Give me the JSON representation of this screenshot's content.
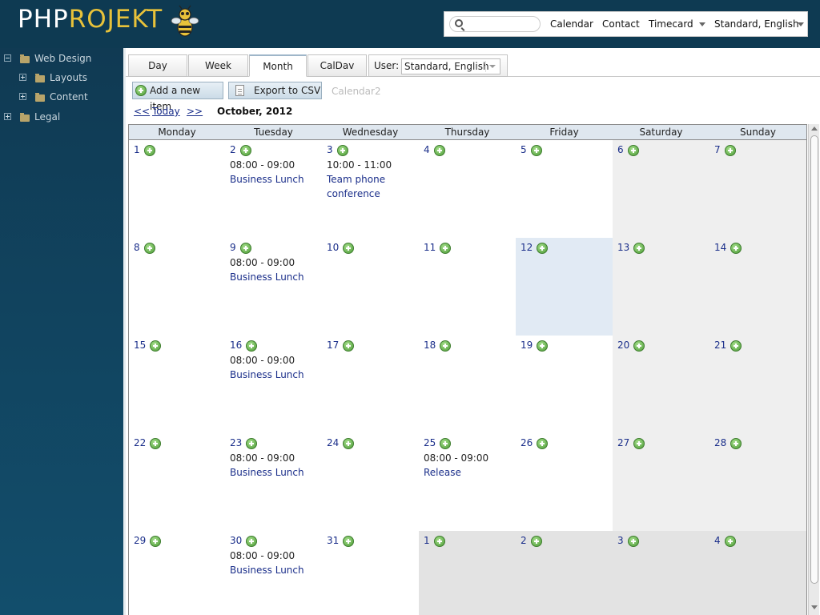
{
  "header": {
    "logo_php": "PHP",
    "logo_projekt": "ROJEKT",
    "nav": [
      "Calendar",
      "Contact",
      "Timecard"
    ],
    "user_menu": "Standard, English",
    "search_placeholder": ""
  },
  "sidebar": {
    "items": [
      {
        "label": "Web Design",
        "expanded": true
      },
      {
        "label": "Layouts"
      },
      {
        "label": "Content"
      },
      {
        "label": "Legal"
      }
    ]
  },
  "tabs": [
    {
      "label": "Day"
    },
    {
      "label": "Week"
    },
    {
      "label": "Month",
      "active": true
    },
    {
      "label": "CalDav"
    }
  ],
  "user_filter": {
    "label": "User:",
    "value": "Standard, English"
  },
  "toolbar": {
    "add_label": "Add a new item",
    "export_label": "Export to CSV",
    "calendar2_label": "Calendar2"
  },
  "nav": {
    "prev": "<<",
    "today": "Today",
    "next": ">>",
    "title": "October, 2012"
  },
  "weekdays": [
    "Monday",
    "Tuesday",
    "Wednesday",
    "Thursday",
    "Friday",
    "Saturday",
    "Sunday"
  ],
  "weeks": [
    [
      {
        "day": "1"
      },
      {
        "day": "2",
        "time": "08:00 - 09:00",
        "title": "Business Lunch"
      },
      {
        "day": "3",
        "time": "10:00 - 11:00",
        "title": "Team phone conference",
        "time_inline": true
      },
      {
        "day": "4"
      },
      {
        "day": "5"
      },
      {
        "day": "6",
        "weekend": true
      },
      {
        "day": "7",
        "weekend": true
      }
    ],
    [
      {
        "day": "8"
      },
      {
        "day": "9",
        "time": "08:00 - 09:00",
        "title": "Business Lunch"
      },
      {
        "day": "10"
      },
      {
        "day": "11"
      },
      {
        "day": "12",
        "today": true
      },
      {
        "day": "13",
        "weekend": true
      },
      {
        "day": "14",
        "weekend": true
      }
    ],
    [
      {
        "day": "15"
      },
      {
        "day": "16",
        "time": "08:00 - 09:00",
        "title": "Business Lunch"
      },
      {
        "day": "17"
      },
      {
        "day": "18"
      },
      {
        "day": "19"
      },
      {
        "day": "20",
        "weekend": true
      },
      {
        "day": "21",
        "weekend": true
      }
    ],
    [
      {
        "day": "22"
      },
      {
        "day": "23",
        "time": "08:00 - 09:00",
        "title": "Business Lunch"
      },
      {
        "day": "24"
      },
      {
        "day": "25",
        "time": "08:00 - 09:00",
        "title": "Release"
      },
      {
        "day": "26"
      },
      {
        "day": "27",
        "weekend": true
      },
      {
        "day": "28",
        "weekend": true
      }
    ],
    [
      {
        "day": "29"
      },
      {
        "day": "30",
        "time": "08:00 - 09:00",
        "title": "Business Lunch"
      },
      {
        "day": "31"
      },
      {
        "day": "1",
        "other": true
      },
      {
        "day": "2",
        "other": true
      },
      {
        "day": "3",
        "other": true
      },
      {
        "day": "4",
        "other": true
      }
    ]
  ]
}
